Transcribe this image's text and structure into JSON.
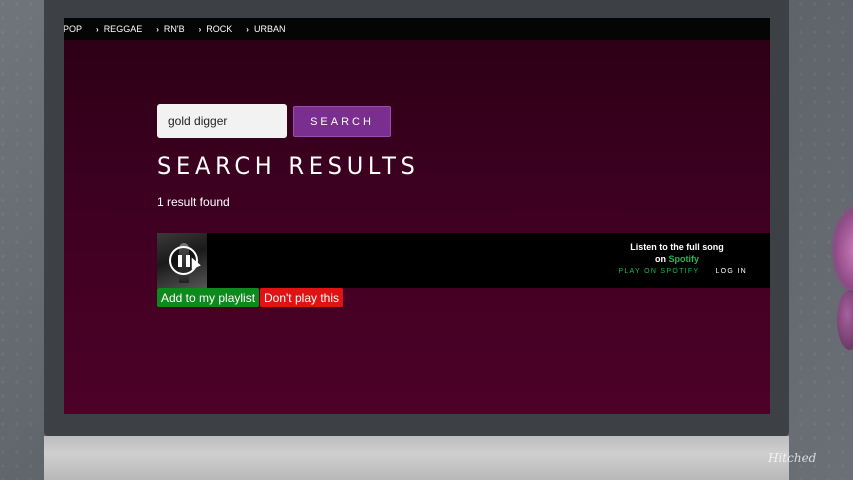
{
  "genres": [
    "POP",
    "REGGAE",
    "RN'B",
    "ROCK",
    "URBAN"
  ],
  "search": {
    "value": "gold digger",
    "button_label": "SEARCH"
  },
  "results": {
    "title": "SEARCH RESULTS",
    "count_text": "1 result found"
  },
  "player": {
    "promo_line1": "Listen to the full song",
    "promo_on": "on",
    "promo_brand": "Spotify",
    "play_link": "PLAY ON SPOTIFY",
    "login_link": "LOG IN"
  },
  "actions": {
    "add_label": "Add to my playlist",
    "dont_label": "Don't play this"
  },
  "watermark": "Hitched",
  "colors": {
    "accent_purple": "#7a2e8f",
    "spotify_green": "#1db954",
    "add_green": "#0d8a1c",
    "dont_red": "#e11212",
    "screen_bg": "#3c0020"
  },
  "icons": [
    "chevron-right-icon",
    "pause-icon",
    "cursor-icon"
  ]
}
